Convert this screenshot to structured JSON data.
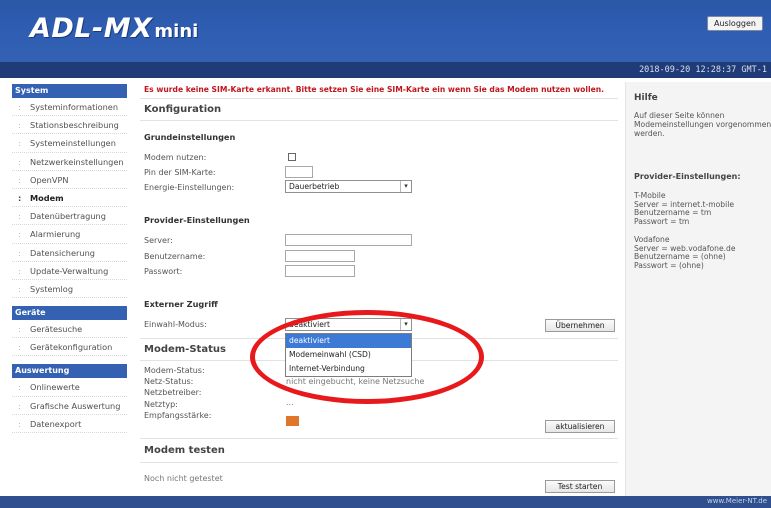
{
  "header": {
    "logo_main": "ADL-MX",
    "logo_sub": "mini",
    "logout_label": "Ausloggen",
    "datetime": "2018-09-20 12:28:37 GMT-1"
  },
  "sidebar": {
    "sections": [
      {
        "title": "System",
        "items": [
          "Systeminformationen",
          "Stationsbeschreibung",
          "Systemeinstellungen",
          "Netzwerkeinstellungen",
          "OpenVPN",
          "Modem",
          "Datenübertragung",
          "Alarmierung",
          "Datensicherung",
          "Update-Verwaltung",
          "Systemlog"
        ]
      },
      {
        "title": "Geräte",
        "items": [
          "Gerätesuche",
          "Gerätekonfiguration"
        ]
      },
      {
        "title": "Auswertung",
        "items": [
          "Onlinewerte",
          "Grafische Auswertung",
          "Datenexport"
        ]
      }
    ],
    "active_item": "Modem"
  },
  "main": {
    "alert": "Es wurde keine SIM-Karte erkannt. Bitte setzen Sie eine SIM-Karte ein wenn Sie das Modem nutzen wollen.",
    "config_title": "Konfiguration",
    "basic": {
      "title": "Grundeinstellungen",
      "modem_use_label": "Modem nutzen:",
      "modem_use_checked": false,
      "sim_pin_label": "Pin der SIM-Karte:",
      "sim_pin_value": "",
      "energy_label": "Energie-Einstellungen:",
      "energy_value": "Dauerbetrieb"
    },
    "provider": {
      "title": "Provider-Einstellungen",
      "server_label": "Server:",
      "server_value": "",
      "user_label": "Benutzername:",
      "user_value": "",
      "password_label": "Passwort:",
      "password_value": ""
    },
    "external": {
      "title": "Externer Zugriff",
      "dial_mode_label": "Einwahl-Modus:",
      "dial_mode_value": "deaktiviert",
      "dial_mode_options": [
        "deaktiviert",
        "Modemeinwahl (CSD)",
        "Internet-Verbindung"
      ],
      "apply_label": "Übernehmen"
    },
    "status": {
      "title": "Modem-Status",
      "modem_status_label": "Modem-Status:",
      "modem_status_value": "",
      "net_status_label": "Netz-Status:",
      "net_status_value": "nicht eingebucht, keine Netzsuche",
      "operator_label": "Netzbetreiber:",
      "operator_value": "",
      "net_type_label": "Netztyp:",
      "net_type_value": "...",
      "signal_label": "Empfangsstärke:",
      "signal_color": "#e0762c",
      "refresh_label": "aktualisieren"
    },
    "test": {
      "title": "Modem testen",
      "result": "Noch nicht getestet",
      "start_label": "Test starten"
    }
  },
  "help": {
    "title": "Hilfe",
    "text": "Auf dieser Seite können Modemeinstellungen vorgenommen werden.",
    "provider_title": "Provider-Einstellungen:",
    "tmobile": [
      "T-Mobile",
      "Server = internet.t-mobile",
      "Benutzername = tm",
      "Passwort = tm"
    ],
    "vodafone": [
      "Vodafone",
      "Server = web.vodafone.de",
      "Benutzername = (ohne)",
      "Passwort = (ohne)"
    ]
  },
  "footer": {
    "text": "www.Meier-NT.de"
  },
  "colors": {
    "header_blue": "#2f5eb3",
    "alert_red": "#c0161c",
    "highlight_ellipse": "#e8191c",
    "dropdown_selected": "#3d7ad6"
  }
}
